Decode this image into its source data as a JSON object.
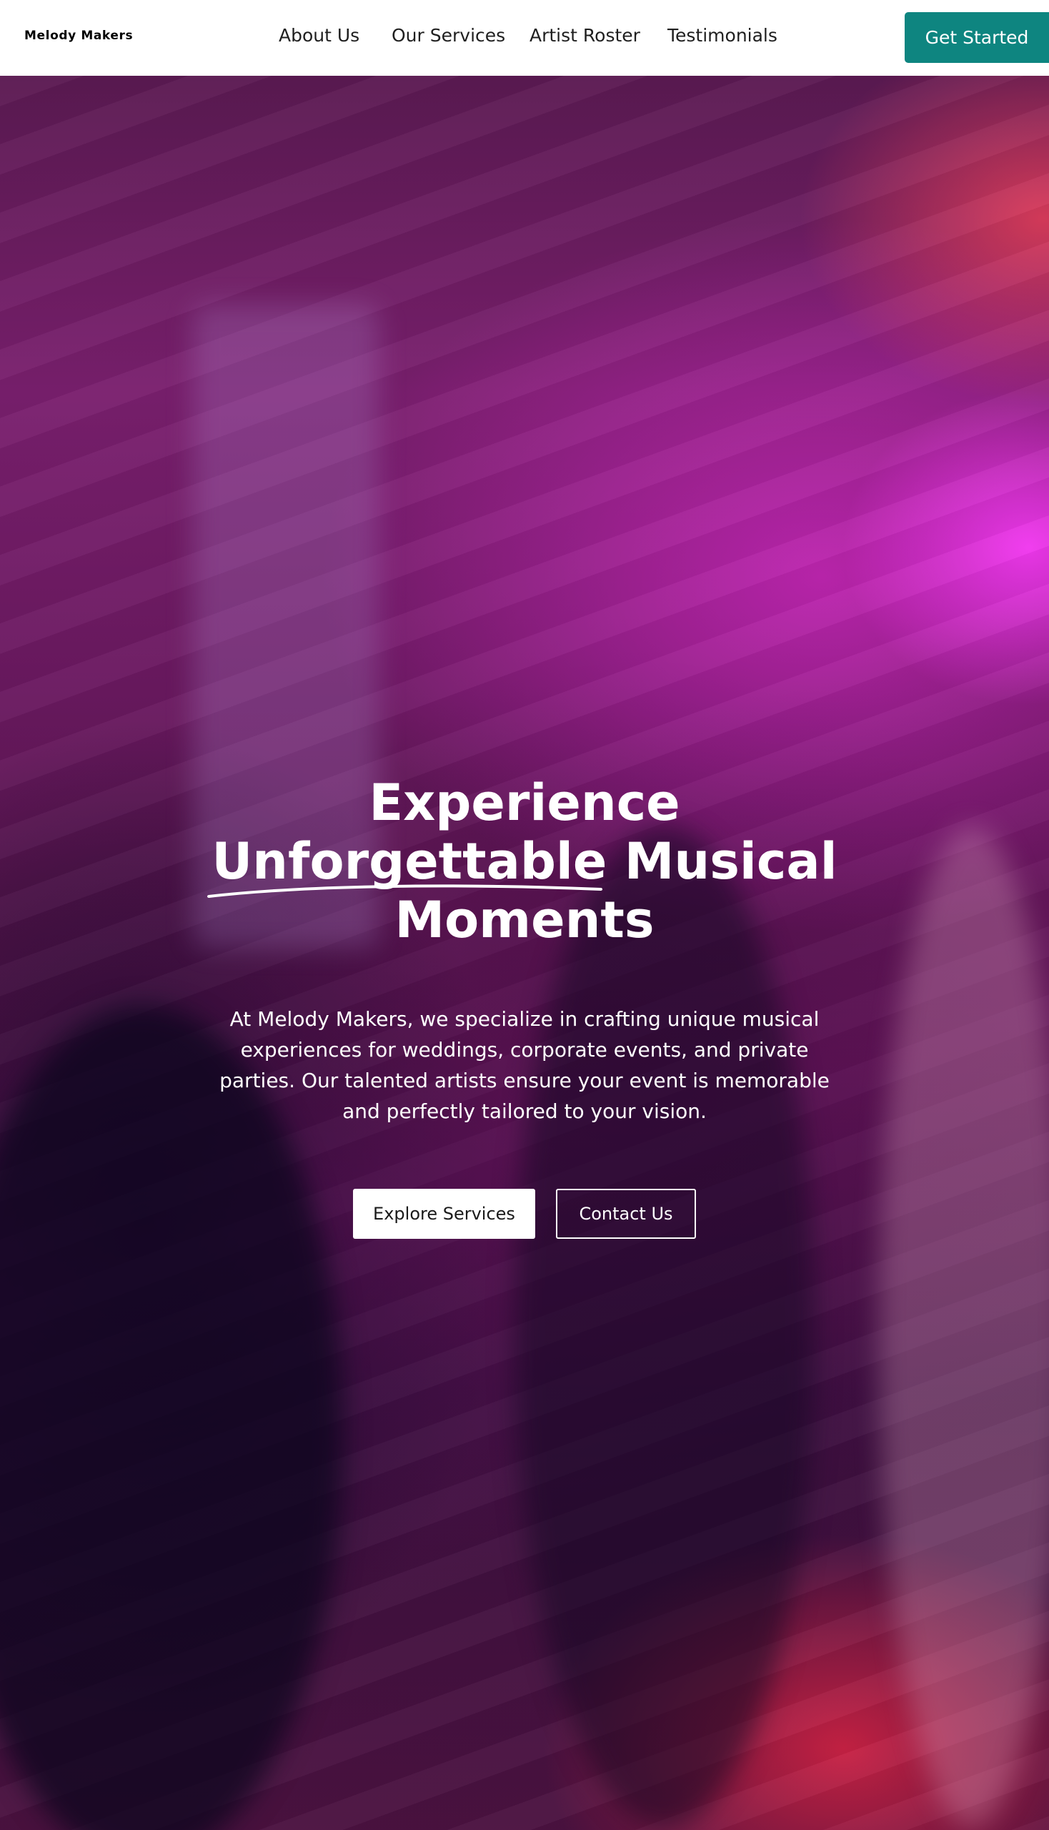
{
  "header": {
    "brand": "Melody Makers",
    "nav": [
      {
        "label": "About Us"
      },
      {
        "label": "Our Services"
      },
      {
        "label": "Artist Roster"
      },
      {
        "label": "Testimonials"
      }
    ],
    "cta_label": "Get Started",
    "cta_color": "#0e8580"
  },
  "hero": {
    "title_line1": "Experience",
    "title_highlight": "Unforgettable",
    "title_rest_line2": " Musical",
    "title_line3": "Moments",
    "description": "At Melody Makers, we specialize in crafting unique musical experiences for weddings, corporate events, and private parties. Our talented artists ensure your event is memorable and perfectly tailored to your vision.",
    "primary_button": "Explore Services",
    "secondary_button": "Contact Us",
    "background_description_color": "#6a1960"
  }
}
